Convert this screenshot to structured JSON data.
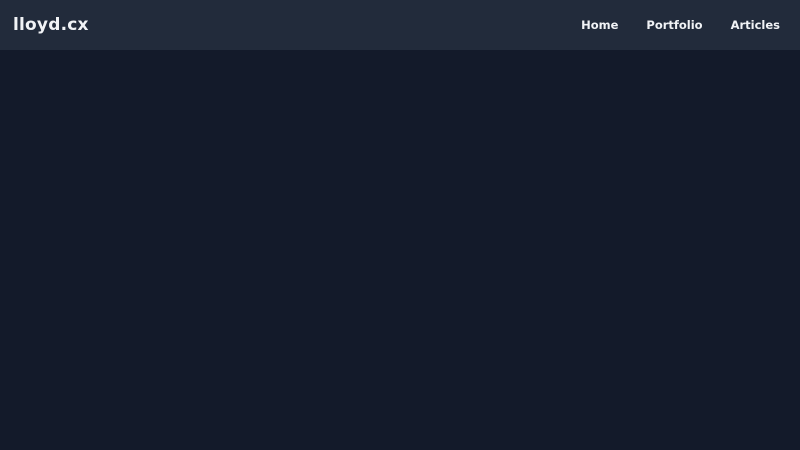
{
  "header": {
    "site_title": "lloyd.cx",
    "nav": [
      {
        "label": "Home"
      },
      {
        "label": "Portfolio"
      },
      {
        "label": "Articles"
      }
    ]
  },
  "colors": {
    "header_bg": "#222b3b",
    "page_bg": "#131a2a",
    "text": "#f1f3f6"
  }
}
